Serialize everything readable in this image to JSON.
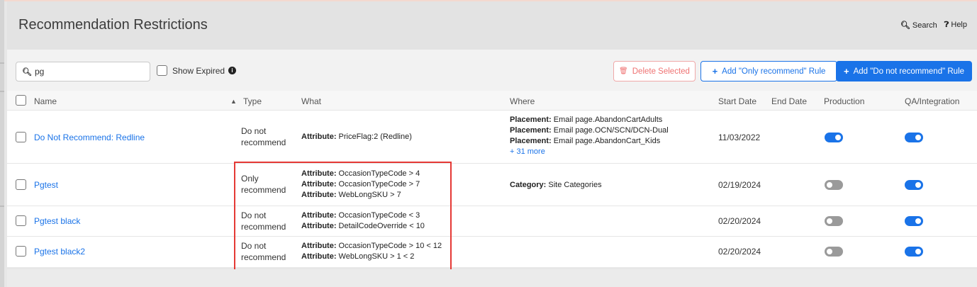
{
  "header": {
    "title": "Recommendation Restrictions",
    "search_label": "Search",
    "help_label": "Help"
  },
  "toolbar": {
    "search_value": "pg",
    "show_expired_label": "Show Expired",
    "delete_label": "Delete Selected",
    "add_only_label": "Add \"Only recommend\" Rule",
    "add_not_label": "Add \"Do not recommend\" Rule"
  },
  "table": {
    "columns": {
      "name": "Name",
      "type": "Type",
      "what": "What",
      "where": "Where",
      "start": "Start Date",
      "end": "End Date",
      "production": "Production",
      "qa": "QA/Integration"
    },
    "rows": [
      {
        "name": "Do Not Recommend: Redline",
        "type1": "Do not",
        "type2": "recommend",
        "what": [
          {
            "label": "Attribute:",
            "value": " PriceFlag:2 (Redline)"
          }
        ],
        "where": [
          {
            "label": "Placement:",
            "value": " Email page.AbandonCartAdults"
          },
          {
            "label": "Placement:",
            "value": " Email page.OCN/SCN/DCN-Dual"
          },
          {
            "label": "Placement:",
            "value": " Email page.AbandonCart_Kids"
          }
        ],
        "where_more": "+ 31 more",
        "start": "11/03/2022",
        "production": "on",
        "qa": "on"
      },
      {
        "name": "Pgtest",
        "type1": "Only",
        "type2": "recommend",
        "what": [
          {
            "label": "Attribute:",
            "value": " OccasionTypeCode > 4"
          },
          {
            "label": "Attribute:",
            "value": " OccasionTypeCode > 7"
          },
          {
            "label": "Attribute:",
            "value": " WebLongSKU > 7"
          }
        ],
        "where": [
          {
            "label": "Category:",
            "value": " Site Categories"
          }
        ],
        "start": "02/19/2024",
        "production": "off",
        "qa": "on"
      },
      {
        "name": "Pgtest black",
        "type1": "Do not",
        "type2": "recommend",
        "what": [
          {
            "label": "Attribute:",
            "value": " OccasionTypeCode < 3"
          },
          {
            "label": "Attribute:",
            "value": " DetailCodeOverride < 10"
          }
        ],
        "start": "02/20/2024",
        "production": "off",
        "qa": "on"
      },
      {
        "name": "Pgtest black2",
        "type1": "Do not",
        "type2": "recommend",
        "what": [
          {
            "label": "Attribute:",
            "value": " OccasionTypeCode > 10 < 12"
          },
          {
            "label": "Attribute:",
            "value": " WebLongSKU > 1 < 2"
          }
        ],
        "start": "02/20/2024",
        "production": "off",
        "qa": "on"
      }
    ]
  },
  "colors": {
    "accent": "#1a73e8",
    "delete": "#ef7272",
    "highlight": "#e53935"
  }
}
